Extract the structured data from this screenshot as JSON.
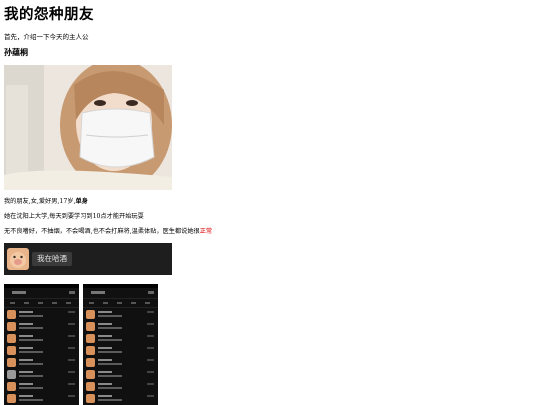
{
  "title": "我的怨种朋友",
  "intro": "首先，介绍一下今天的主人公",
  "person_name": "孙蕴桐",
  "photo": {
    "icon": "friend-selfie-with-mask"
  },
  "paragraphs": {
    "line1_normal": "我的朋友,女,爱好男,17岁,",
    "line1_bold": "单身",
    "line2": "她在沈阳上大学,每天到要学习到10点才能开始玩耍",
    "line3_normal": "无不良嗜好，不抽烟，不会喝酒,也不会打麻将,温柔体贴，医生都说她很",
    "line3_red": "正常"
  },
  "banner": {
    "emoji_icon": "pig-face-sticker",
    "tag": "我在哈酒"
  },
  "screenshots": {
    "icon": "chat-list-screenshot",
    "left_rows": 8,
    "right_rows": 8
  },
  "colors": {
    "accent_red": "#dd0000",
    "dark_bg": "#1e1e1e"
  }
}
